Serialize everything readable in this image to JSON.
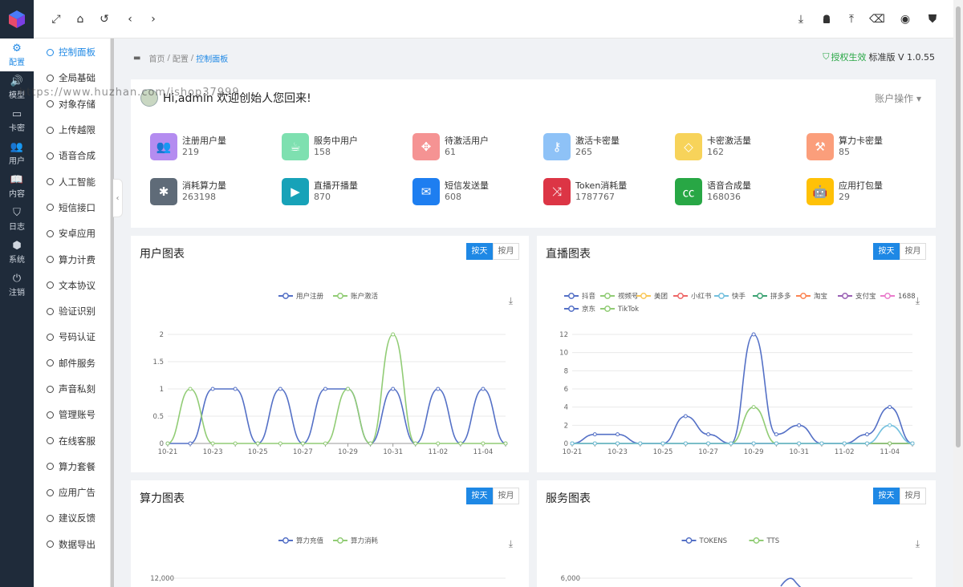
{
  "rail": [
    {
      "label": "配置",
      "icon": "sliders-icon",
      "glyph": "⚙",
      "active": true
    },
    {
      "label": "模型",
      "icon": "speaker-icon",
      "glyph": "🔊"
    },
    {
      "label": "卡密",
      "icon": "card-icon",
      "glyph": "▭"
    },
    {
      "label": "用户",
      "icon": "users-icon",
      "glyph": "👥"
    },
    {
      "label": "内容",
      "icon": "book-icon",
      "glyph": "📖"
    },
    {
      "label": "日志",
      "icon": "shield-icon",
      "glyph": "⛉"
    },
    {
      "label": "系统",
      "icon": "cube-icon",
      "glyph": "⬢"
    },
    {
      "label": "注销",
      "icon": "power-icon",
      "glyph": "⏻"
    }
  ],
  "submenu": [
    "控制面板",
    "全局基础",
    "对象存储",
    "上传越限",
    "语音合成",
    "人工智能",
    "短信接口",
    "安卓应用",
    "算力计费",
    "文本协议",
    "验证识别",
    "号码认证",
    "邮件服务",
    "声音私刻",
    "管理账号",
    "在线客服",
    "算力套餐",
    "应用广告",
    "建议反馈",
    "数据导出"
  ],
  "breadcrumb": {
    "home": "首页",
    "mid": "配置",
    "current": "控制面板"
  },
  "license": {
    "status": "授权生效",
    "edition": "标准版 V 1.0.55"
  },
  "welcome": "Hi,admin 欢迎创始人您回来!",
  "account_menu": "账户操作",
  "watermark": "https://www.huzhan.com/ishop37999",
  "stats": [
    {
      "label": "注册用户量",
      "value": "219",
      "color": "#b48cf0",
      "icon": "users-icon",
      "glyph": "👥"
    },
    {
      "label": "服务中用户",
      "value": "158",
      "color": "#7ee0b0",
      "icon": "coffee-icon",
      "glyph": "☕"
    },
    {
      "label": "待激活用户",
      "value": "61",
      "color": "#f59393",
      "icon": "crosshair-icon",
      "glyph": "✥"
    },
    {
      "label": "激活卡密量",
      "value": "265",
      "color": "#8ec2f7",
      "icon": "key-icon",
      "glyph": "⚷"
    },
    {
      "label": "卡密激活量",
      "value": "162",
      "color": "#f7d35a",
      "icon": "diamond-icon",
      "glyph": "◇"
    },
    {
      "label": "算力卡密量",
      "value": "85",
      "color": "#fb9e7b",
      "icon": "gavel-icon",
      "glyph": "⚒"
    },
    {
      "label": "消耗算力量",
      "value": "263198",
      "color": "#5f6b78",
      "icon": "yelp-icon",
      "glyph": "✱"
    },
    {
      "label": "直播开播量",
      "value": "870",
      "color": "#17a2b8",
      "icon": "video-icon",
      "glyph": "▶"
    },
    {
      "label": "短信发送量",
      "value": "608",
      "color": "#1e7ef0",
      "icon": "envelope-icon",
      "glyph": "✉"
    },
    {
      "label": "Token消耗量",
      "value": "1787767",
      "color": "#dc3545",
      "icon": "shuffle-icon",
      "glyph": "⤨"
    },
    {
      "label": "语音合成量",
      "value": "168036",
      "color": "#28a745",
      "icon": "cc-icon",
      "glyph": "㏄"
    },
    {
      "label": "应用打包量",
      "value": "29",
      "color": "#ffc107",
      "icon": "android-icon",
      "glyph": "🤖"
    }
  ],
  "btn_day": "按天",
  "btn_month": "按月",
  "chart_data": [
    {
      "type": "line",
      "title": "用户图表",
      "x": [
        "10-21",
        "10-22",
        "10-23",
        "10-24",
        "10-25",
        "10-26",
        "10-27",
        "10-28",
        "10-29",
        "10-30",
        "10-31",
        "11-01",
        "11-02",
        "11-03",
        "11-04",
        "11-05"
      ],
      "x_ticks": [
        "10-21",
        "10-23",
        "10-25",
        "10-27",
        "10-29",
        "10-31",
        "11-02",
        "11-04"
      ],
      "y_ticks": [
        "0",
        "0.5",
        "1",
        "1.5",
        "2"
      ],
      "ylim": [
        0,
        2
      ],
      "series": [
        {
          "name": "用户注册",
          "color": "#5470c6",
          "values": [
            0,
            0,
            1,
            1,
            0,
            1,
            0,
            1,
            1,
            0,
            1,
            0,
            1,
            0,
            1,
            0
          ]
        },
        {
          "name": "账户激活",
          "color": "#91cc75",
          "values": [
            0,
            1,
            0,
            0,
            0,
            0,
            0,
            0,
            1,
            0,
            2,
            0,
            0,
            0,
            0,
            0
          ]
        }
      ],
      "legend": "top-center"
    },
    {
      "type": "line",
      "title": "直播图表",
      "x": [
        "10-21",
        "10-22",
        "10-23",
        "10-24",
        "10-25",
        "10-26",
        "10-27",
        "10-28",
        "10-29",
        "10-30",
        "10-31",
        "11-01",
        "11-02",
        "11-03",
        "11-04",
        "11-05"
      ],
      "x_ticks": [
        "10-21",
        "10-23",
        "10-25",
        "10-27",
        "10-29",
        "10-31",
        "11-02",
        "11-04"
      ],
      "y_ticks": [
        "0",
        "2",
        "4",
        "6",
        "8",
        "10",
        "12"
      ],
      "ylim": [
        0,
        12
      ],
      "series": [
        {
          "name": "抖音",
          "color": "#5470c6",
          "values": [
            0,
            1,
            1,
            0,
            0,
            3,
            1,
            0,
            12,
            1,
            2,
            0,
            0,
            1,
            4,
            0
          ]
        },
        {
          "name": "视频号",
          "color": "#91cc75",
          "values": [
            0,
            0,
            0,
            0,
            0,
            0,
            0,
            0,
            4,
            0,
            0,
            0,
            0,
            0,
            0,
            0
          ]
        },
        {
          "name": "美团",
          "color": "#fac858",
          "values": [
            0,
            0,
            0,
            0,
            0,
            0,
            0,
            0,
            0,
            0,
            0,
            0,
            0,
            0,
            0,
            0
          ]
        },
        {
          "name": "小红书",
          "color": "#ee6666",
          "values": [
            0,
            0,
            0,
            0,
            0,
            0,
            0,
            0,
            0,
            0,
            0,
            0,
            0,
            0,
            0,
            0
          ]
        },
        {
          "name": "快手",
          "color": "#73c0de",
          "values": [
            0,
            0,
            0,
            0,
            0,
            0,
            0,
            0,
            0,
            0,
            0,
            0,
            0,
            0,
            2,
            0
          ]
        },
        {
          "name": "拼多多",
          "color": "#3ba272",
          "values": [
            0,
            0,
            0,
            0,
            0,
            0,
            0,
            0,
            0,
            0,
            0,
            0,
            0,
            0,
            0,
            0
          ]
        },
        {
          "name": "淘宝",
          "color": "#fc8452",
          "values": [
            0,
            0,
            0,
            0,
            0,
            0,
            0,
            0,
            0,
            0,
            0,
            0,
            0,
            0,
            0,
            0
          ]
        },
        {
          "name": "支付宝",
          "color": "#9a60b4",
          "values": [
            0,
            0,
            0,
            0,
            0,
            0,
            0,
            0,
            0,
            0,
            0,
            0,
            0,
            0,
            0,
            0
          ]
        },
        {
          "name": "1688",
          "color": "#ea7ccc",
          "values": [
            0,
            0,
            0,
            0,
            0,
            0,
            0,
            0,
            0,
            0,
            0,
            0,
            0,
            0,
            0,
            0
          ]
        },
        {
          "name": "京东",
          "color": "#5470c6",
          "values": [
            0,
            0,
            0,
            0,
            0,
            0,
            0,
            0,
            0,
            0,
            0,
            0,
            0,
            0,
            0,
            0
          ]
        },
        {
          "name": "TikTok",
          "color": "#91cc75",
          "values": [
            0,
            0,
            0,
            0,
            0,
            0,
            0,
            0,
            0,
            0,
            0,
            0,
            0,
            0,
            0,
            0
          ]
        }
      ],
      "legend": "top-left"
    },
    {
      "type": "line",
      "title": "算力图表",
      "y_ticks": [
        "12,000"
      ],
      "series": [
        {
          "name": "算力充值",
          "color": "#5470c6"
        },
        {
          "name": "算力消耗",
          "color": "#91cc75"
        }
      ],
      "legend": "top-center"
    },
    {
      "type": "line",
      "title": "服务图表",
      "y_ticks": [
        "6,000"
      ],
      "series": [
        {
          "name": "TOKENS",
          "color": "#5470c6"
        },
        {
          "name": "TTS",
          "color": "#91cc75"
        }
      ],
      "legend": "top-center"
    }
  ]
}
